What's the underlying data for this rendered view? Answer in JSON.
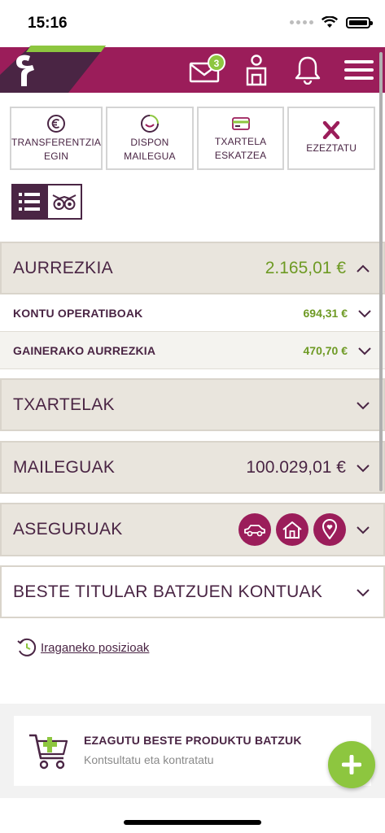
{
  "status_bar": {
    "time": "15:16"
  },
  "header": {
    "notification_count": "3"
  },
  "quick_actions": [
    {
      "label": "TRANSFERENTZIA\nEGIN",
      "icon": "euro-icon"
    },
    {
      "label": "DISPON\nMAILEGUA",
      "icon": "smile-icon"
    },
    {
      "label": "TXARTELA\nESKATZEA",
      "icon": "card-icon"
    },
    {
      "label": "EZEZTATU",
      "icon": "cancel-icon"
    }
  ],
  "sections": {
    "savings": {
      "title": "AURREZKIA",
      "amount": "2.165,01 €"
    },
    "savings_rows": [
      {
        "label": "KONTU OPERATIBOAK",
        "amount": "694,31 €"
      },
      {
        "label": "GAINERAKO AURREZKIA",
        "amount": "470,70 €"
      }
    ],
    "cards": {
      "title": "TXARTELAK"
    },
    "loans": {
      "title": "MAILEGUAK",
      "amount": "100.029,01 €"
    },
    "insurance": {
      "title": "ASEGURUAK",
      "icons": [
        "car-icon",
        "home-icon",
        "location-pin-icon"
      ]
    },
    "other_holders": {
      "title": "BESTE TITULAR BATZUEN KONTUAK"
    }
  },
  "past_positions": {
    "label": "Iraganeko posizioak"
  },
  "promo": {
    "title": "EZAGUTU BESTE PRODUKTU BATZUK",
    "subtitle": "Kontsultatu eta kontratatu"
  },
  "colors": {
    "brand": "#9b1d5a",
    "dark_purple": "#4a2544",
    "positive_green": "#6e9a24",
    "fab_green": "#8dc63f",
    "section_bg": "#e9e5dd"
  }
}
